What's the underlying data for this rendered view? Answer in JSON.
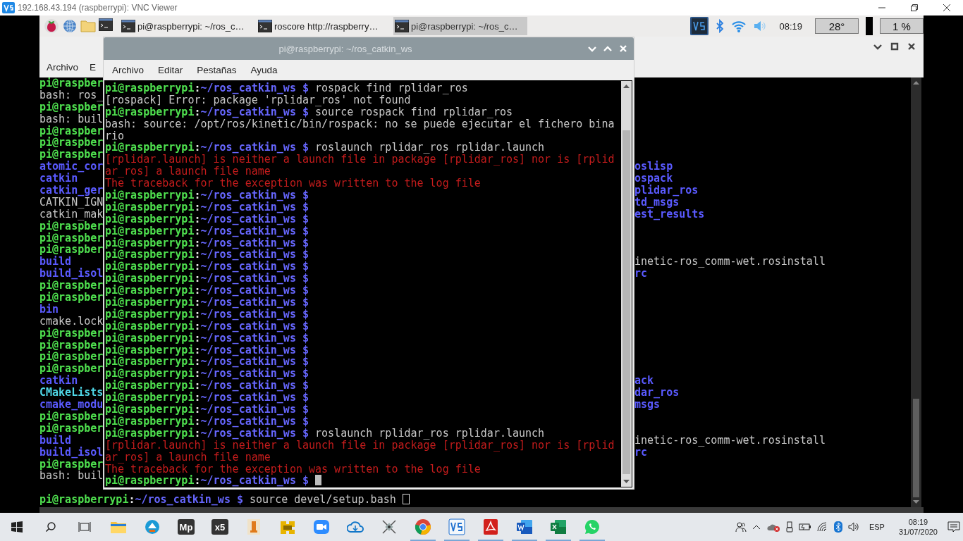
{
  "viewer": {
    "title": "192.168.43.194 (raspberrypi): VNC Viewer"
  },
  "pi_panel": {
    "tasks": [
      {
        "label": "pi@raspberrypi: ~/ros_c…",
        "selected": false
      },
      {
        "label": "roscore http://raspberry…",
        "selected": false
      },
      {
        "label": "pi@raspberrypi: ~/ros_c…",
        "selected": true
      }
    ],
    "clock": "08:19",
    "temperature": "28°",
    "cpu": "1 %"
  },
  "back_terminal": {
    "menu": [
      "Archivo",
      "E"
    ],
    "rows": [
      {
        "left": {
          "kind": "user",
          "text": "pi@raspber"
        }
      },
      {
        "left": {
          "kind": "output",
          "text": "bash: ros_"
        }
      },
      {
        "left": {
          "kind": "user",
          "text": "pi@raspber"
        }
      },
      {
        "left": {
          "kind": "output",
          "text": "bash: buil"
        }
      },
      {
        "left": {
          "kind": "user",
          "text": "pi@raspber"
        }
      },
      {
        "left": {
          "kind": "user",
          "text": "pi@raspber"
        }
      },
      {
        "left": {
          "kind": "user",
          "text": "pi@raspber"
        }
      },
      {
        "left": {
          "kind": "dir",
          "text": "atomic_cor"
        },
        "right": {
          "kind": "dir",
          "text": "oslisp"
        }
      },
      {
        "left": {
          "kind": "dir",
          "text": "catkin"
        },
        "right": {
          "kind": "dir",
          "text": "ospack"
        }
      },
      {
        "left": {
          "kind": "dir",
          "text": "catkin_ger"
        },
        "right": {
          "kind": "dir",
          "text": "plidar_ros"
        }
      },
      {
        "left": {
          "kind": "output",
          "text": "CATKIN_IGN"
        },
        "right": {
          "kind": "dir",
          "text": "td_msgs"
        }
      },
      {
        "left": {
          "kind": "output",
          "text": "catkin_mak"
        },
        "right": {
          "kind": "dir",
          "text": "est_results"
        }
      },
      {
        "left": {
          "kind": "user",
          "text": "pi@raspber"
        }
      },
      {
        "left": {
          "kind": "user",
          "text": "pi@raspber"
        }
      },
      {
        "left": {
          "kind": "user",
          "text": "pi@raspber"
        }
      },
      {
        "left": {
          "kind": "dir",
          "text": "build"
        },
        "right": {
          "kind": "output",
          "text": "inetic-ros_comm-wet.rosinstall"
        }
      },
      {
        "left": {
          "kind": "dir",
          "text": "build_isol"
        },
        "right": {
          "kind": "dir",
          "text": "rc"
        }
      },
      {
        "left": {
          "kind": "user",
          "text": "pi@raspber"
        }
      },
      {
        "left": {
          "kind": "user",
          "text": "pi@raspber"
        }
      },
      {
        "left": {
          "kind": "dir",
          "text": "bin"
        }
      },
      {
        "left": {
          "kind": "output",
          "text": "cmake.lock"
        }
      },
      {
        "left": {
          "kind": "user",
          "text": "pi@raspber"
        }
      },
      {
        "left": {
          "kind": "user",
          "text": "pi@raspber"
        }
      },
      {
        "left": {
          "kind": "user",
          "text": "pi@raspber"
        }
      },
      {
        "left": {
          "kind": "user",
          "text": "pi@raspber"
        }
      },
      {
        "left": {
          "kind": "dir",
          "text": "catkin"
        },
        "right": {
          "kind": "dir",
          "text": "ack"
        }
      },
      {
        "left": {
          "kind": "exec",
          "text": "CMakeLists"
        },
        "right": {
          "kind": "dir",
          "text": "dar_ros"
        }
      },
      {
        "left": {
          "kind": "dir",
          "text": "cmake_modu"
        },
        "right": {
          "kind": "dir",
          "text": "msgs"
        }
      },
      {
        "left": {
          "kind": "user",
          "text": "pi@raspber"
        }
      },
      {
        "left": {
          "kind": "user",
          "text": "pi@raspber"
        }
      },
      {
        "left": {
          "kind": "dir",
          "text": "build"
        },
        "right": {
          "kind": "output",
          "text": "inetic-ros_comm-wet.rosinstall"
        }
      },
      {
        "left": {
          "kind": "dir",
          "text": "build_isol"
        },
        "right": {
          "kind": "dir",
          "text": "rc"
        }
      },
      {
        "left": {
          "kind": "user",
          "text": "pi@raspber"
        }
      },
      {
        "left": {
          "kind": "output",
          "text": "bash: buil"
        }
      },
      {},
      {
        "full": [
          {
            "kind": "user",
            "text": "pi@raspberrypi"
          },
          {
            "kind": "sep",
            "text": ":"
          },
          {
            "kind": "path",
            "text": "~/ros_catkin_ws $"
          },
          {
            "kind": "command",
            "text": "source devel/setup.bash"
          }
        ],
        "cursor": true
      }
    ]
  },
  "front_terminal": {
    "title": "pi@raspberrypi: ~/ros_catkin_ws",
    "menu": [
      "Archivo",
      "Editar",
      "Pestañas",
      "Ayuda"
    ],
    "lines": [
      {
        "segments": [
          {
            "kind": "user",
            "text": "pi@raspberrypi"
          },
          {
            "kind": "sep",
            "text": ":"
          },
          {
            "kind": "path",
            "text": "~/ros_catkin_ws $"
          },
          {
            "kind": "command",
            "text": "rospack find rplidar_ros"
          }
        ]
      },
      {
        "segments": [
          {
            "kind": "output",
            "text": "[rospack] Error: package 'rplidar_ros' not found"
          }
        ]
      },
      {
        "segments": [
          {
            "kind": "user",
            "text": "pi@raspberrypi"
          },
          {
            "kind": "sep",
            "text": ":"
          },
          {
            "kind": "path",
            "text": "~/ros_catkin_ws $"
          },
          {
            "kind": "command",
            "text": "source rospack find rplidar_ros"
          }
        ]
      },
      {
        "segments": [
          {
            "kind": "output",
            "text": "bash: source: /opt/ros/kinetic/bin/rospack: no se puede ejecutar el fichero bina"
          }
        ]
      },
      {
        "segments": [
          {
            "kind": "output",
            "text": "rio"
          }
        ]
      },
      {
        "segments": [
          {
            "kind": "user",
            "text": "pi@raspberrypi"
          },
          {
            "kind": "sep",
            "text": ":"
          },
          {
            "kind": "path",
            "text": "~/ros_catkin_ws $"
          },
          {
            "kind": "command",
            "text": "roslaunch rplidar_ros rplidar.launch"
          }
        ]
      },
      {
        "segments": [
          {
            "kind": "error",
            "text": "[rplidar.launch] is neither a launch file in package [rplidar_ros] nor is [rplid"
          }
        ]
      },
      {
        "segments": [
          {
            "kind": "error",
            "text": "ar_ros] a launch file name"
          }
        ]
      },
      {
        "segments": [
          {
            "kind": "error",
            "text": "The traceback for the exception was written to the log file"
          }
        ]
      },
      {
        "segments": [
          {
            "kind": "user",
            "text": "pi@raspberrypi"
          },
          {
            "kind": "sep",
            "text": ":"
          },
          {
            "kind": "path",
            "text": "~/ros_catkin_ws $"
          }
        ]
      },
      {
        "segments": [
          {
            "kind": "user",
            "text": "pi@raspberrypi"
          },
          {
            "kind": "sep",
            "text": ":"
          },
          {
            "kind": "path",
            "text": "~/ros_catkin_ws $"
          }
        ]
      },
      {
        "segments": [
          {
            "kind": "user",
            "text": "pi@raspberrypi"
          },
          {
            "kind": "sep",
            "text": ":"
          },
          {
            "kind": "path",
            "text": "~/ros_catkin_ws $"
          }
        ]
      },
      {
        "segments": [
          {
            "kind": "user",
            "text": "pi@raspberrypi"
          },
          {
            "kind": "sep",
            "text": ":"
          },
          {
            "kind": "path",
            "text": "~/ros_catkin_ws $"
          }
        ]
      },
      {
        "segments": [
          {
            "kind": "user",
            "text": "pi@raspberrypi"
          },
          {
            "kind": "sep",
            "text": ":"
          },
          {
            "kind": "path",
            "text": "~/ros_catkin_ws $"
          }
        ]
      },
      {
        "segments": [
          {
            "kind": "user",
            "text": "pi@raspberrypi"
          },
          {
            "kind": "sep",
            "text": ":"
          },
          {
            "kind": "path",
            "text": "~/ros_catkin_ws $"
          }
        ]
      },
      {
        "segments": [
          {
            "kind": "user",
            "text": "pi@raspberrypi"
          },
          {
            "kind": "sep",
            "text": ":"
          },
          {
            "kind": "path",
            "text": "~/ros_catkin_ws $"
          }
        ]
      },
      {
        "segments": [
          {
            "kind": "user",
            "text": "pi@raspberrypi"
          },
          {
            "kind": "sep",
            "text": ":"
          },
          {
            "kind": "path",
            "text": "~/ros_catkin_ws $"
          }
        ]
      },
      {
        "segments": [
          {
            "kind": "user",
            "text": "pi@raspberrypi"
          },
          {
            "kind": "sep",
            "text": ":"
          },
          {
            "kind": "path",
            "text": "~/ros_catkin_ws $"
          }
        ]
      },
      {
        "segments": [
          {
            "kind": "user",
            "text": "pi@raspberrypi"
          },
          {
            "kind": "sep",
            "text": ":"
          },
          {
            "kind": "path",
            "text": "~/ros_catkin_ws $"
          }
        ]
      },
      {
        "segments": [
          {
            "kind": "user",
            "text": "pi@raspberrypi"
          },
          {
            "kind": "sep",
            "text": ":"
          },
          {
            "kind": "path",
            "text": "~/ros_catkin_ws $"
          }
        ]
      },
      {
        "segments": [
          {
            "kind": "user",
            "text": "pi@raspberrypi"
          },
          {
            "kind": "sep",
            "text": ":"
          },
          {
            "kind": "path",
            "text": "~/ros_catkin_ws $"
          }
        ]
      },
      {
        "segments": [
          {
            "kind": "user",
            "text": "pi@raspberrypi"
          },
          {
            "kind": "sep",
            "text": ":"
          },
          {
            "kind": "path",
            "text": "~/ros_catkin_ws $"
          }
        ]
      },
      {
        "segments": [
          {
            "kind": "user",
            "text": "pi@raspberrypi"
          },
          {
            "kind": "sep",
            "text": ":"
          },
          {
            "kind": "path",
            "text": "~/ros_catkin_ws $"
          }
        ]
      },
      {
        "segments": [
          {
            "kind": "user",
            "text": "pi@raspberrypi"
          },
          {
            "kind": "sep",
            "text": ":"
          },
          {
            "kind": "path",
            "text": "~/ros_catkin_ws $"
          }
        ]
      },
      {
        "segments": [
          {
            "kind": "user",
            "text": "pi@raspberrypi"
          },
          {
            "kind": "sep",
            "text": ":"
          },
          {
            "kind": "path",
            "text": "~/ros_catkin_ws $"
          }
        ]
      },
      {
        "segments": [
          {
            "kind": "user",
            "text": "pi@raspberrypi"
          },
          {
            "kind": "sep",
            "text": ":"
          },
          {
            "kind": "path",
            "text": "~/ros_catkin_ws $"
          }
        ]
      },
      {
        "segments": [
          {
            "kind": "user",
            "text": "pi@raspberrypi"
          },
          {
            "kind": "sep",
            "text": ":"
          },
          {
            "kind": "path",
            "text": "~/ros_catkin_ws $"
          }
        ]
      },
      {
        "segments": [
          {
            "kind": "user",
            "text": "pi@raspberrypi"
          },
          {
            "kind": "sep",
            "text": ":"
          },
          {
            "kind": "path",
            "text": "~/ros_catkin_ws $"
          }
        ]
      },
      {
        "segments": [
          {
            "kind": "user",
            "text": "pi@raspberrypi"
          },
          {
            "kind": "sep",
            "text": ":"
          },
          {
            "kind": "path",
            "text": "~/ros_catkin_ws $"
          }
        ]
      },
      {
        "segments": [
          {
            "kind": "user",
            "text": "pi@raspberrypi"
          },
          {
            "kind": "sep",
            "text": ":"
          },
          {
            "kind": "path",
            "text": "~/ros_catkin_ws $"
          },
          {
            "kind": "command",
            "text": "roslaunch rplidar_ros rplidar.launch"
          }
        ]
      },
      {
        "segments": [
          {
            "kind": "error",
            "text": "[rplidar.launch] is neither a launch file in package [rplidar_ros] nor is [rplid"
          }
        ]
      },
      {
        "segments": [
          {
            "kind": "error",
            "text": "ar_ros] a launch file name"
          }
        ]
      },
      {
        "segments": [
          {
            "kind": "error",
            "text": "The traceback for the exception was written to the log file"
          }
        ]
      },
      {
        "segments": [
          {
            "kind": "user",
            "text": "pi@raspberrypi"
          },
          {
            "kind": "sep",
            "text": ":"
          },
          {
            "kind": "path",
            "text": "~/ros_catkin_ws $"
          }
        ],
        "cursor": true
      }
    ]
  },
  "taskbar": {
    "apps": [
      {
        "kind": "folder",
        "running": false
      },
      {
        "kind": "badge",
        "running": false
      },
      {
        "kind": "tile",
        "glyph": "Mp",
        "running": false
      },
      {
        "kind": "tile",
        "glyph": "x5",
        "running": false
      },
      {
        "kind": "orange",
        "running": false
      },
      {
        "kind": "puzzle",
        "running": false
      },
      {
        "kind": "camera",
        "running": false
      },
      {
        "kind": "cloud",
        "running": false
      },
      {
        "kind": "satellite",
        "running": false
      },
      {
        "kind": "chrome",
        "running": true
      },
      {
        "kind": "vnc",
        "running": true
      },
      {
        "kind": "pdf",
        "running": true
      },
      {
        "kind": "word",
        "running": true
      },
      {
        "kind": "excel",
        "running": true
      },
      {
        "kind": "chat",
        "running": true
      }
    ],
    "language": "ESP",
    "time": "08:19",
    "date": "31/07/2020"
  }
}
